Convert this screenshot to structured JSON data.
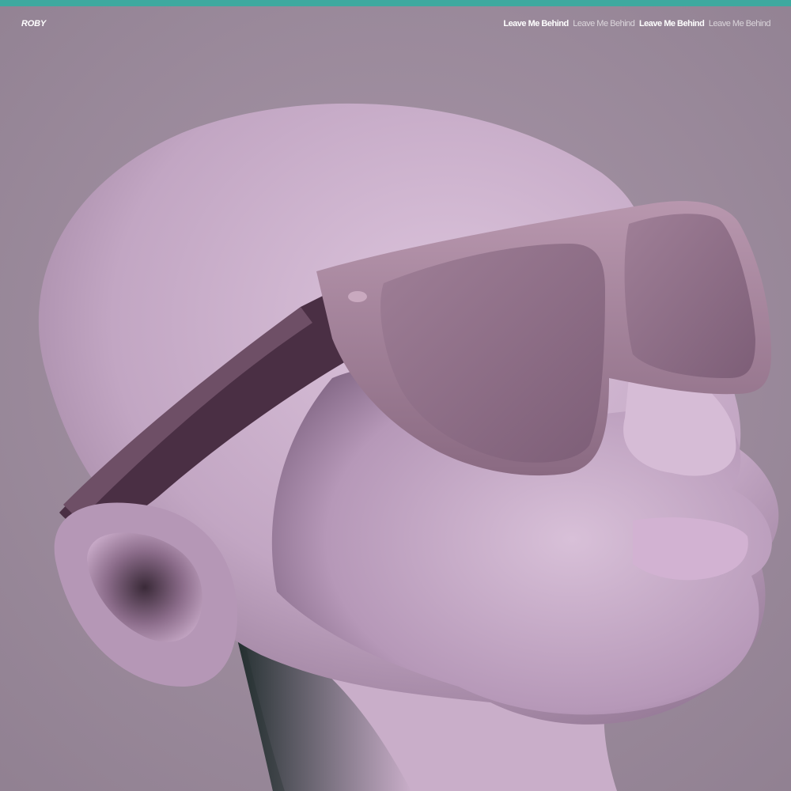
{
  "cover": {
    "artist": "ROBY",
    "title_repeats": [
      {
        "text": "Leave Me Behind",
        "weight": "bold"
      },
      {
        "text": "Leave Me Behind",
        "weight": "light"
      },
      {
        "text": "Leave Me Behind",
        "weight": "bold"
      },
      {
        "text": "Leave Me Behind",
        "weight": "light"
      }
    ]
  },
  "colors": {
    "accent_bar": "#3ea99f",
    "background": "#9d8c9d",
    "bust": "#c9aec9",
    "glasses": "#9a7690",
    "shadow": "#1f2a2a"
  }
}
